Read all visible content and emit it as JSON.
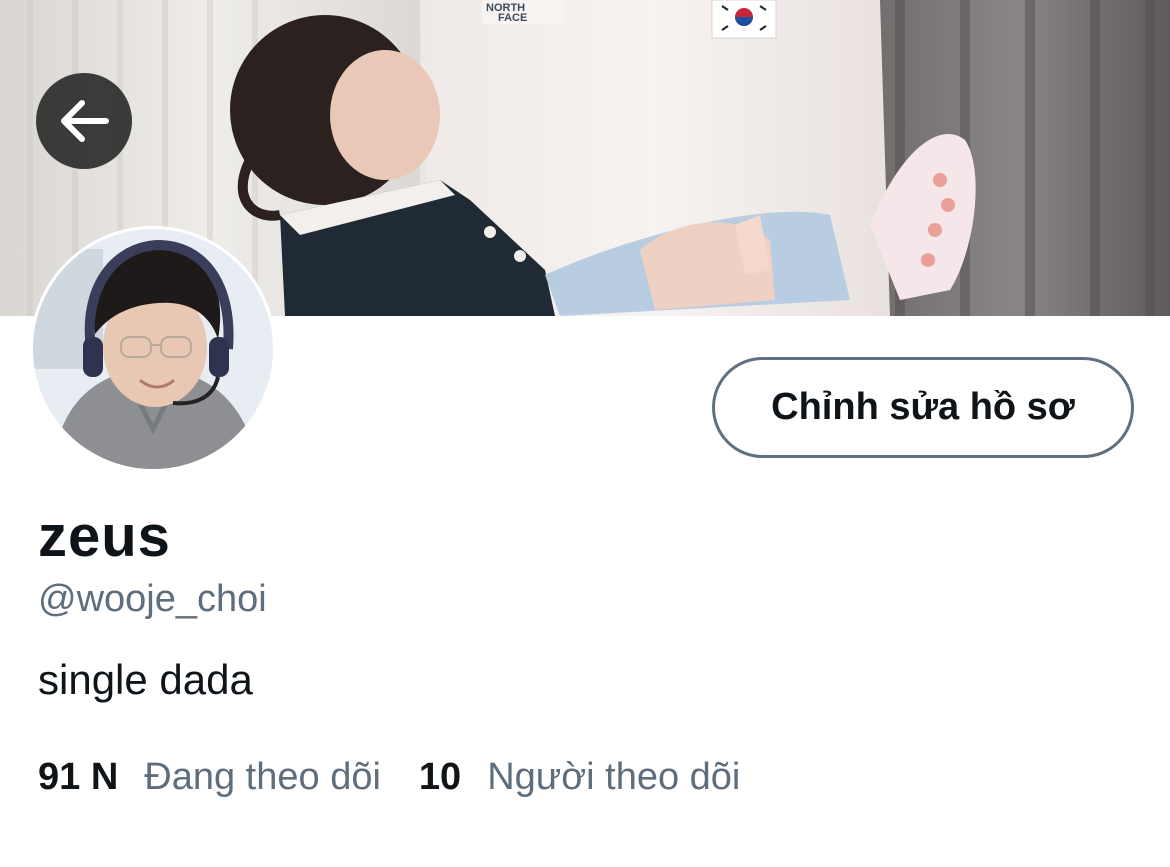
{
  "header": {
    "back_icon": "arrow-left-icon",
    "banner_jersey_brand": "THE NORTH FACE",
    "banner_jersey_flag_icon": "south-korea-flag-icon"
  },
  "profile": {
    "display_name": "zeus",
    "handle": "@wooje_choi",
    "bio": "single dada",
    "edit_button_label": "Chỉnh sửa hồ sơ"
  },
  "stats": {
    "following_count": "91 N",
    "following_label": "Đang theo dõi",
    "followers_count": "10",
    "followers_label": "Người theo dõi"
  },
  "colors": {
    "text_primary": "#0f1419",
    "text_secondary": "#5f6e7c",
    "button_border": "#60707f"
  }
}
